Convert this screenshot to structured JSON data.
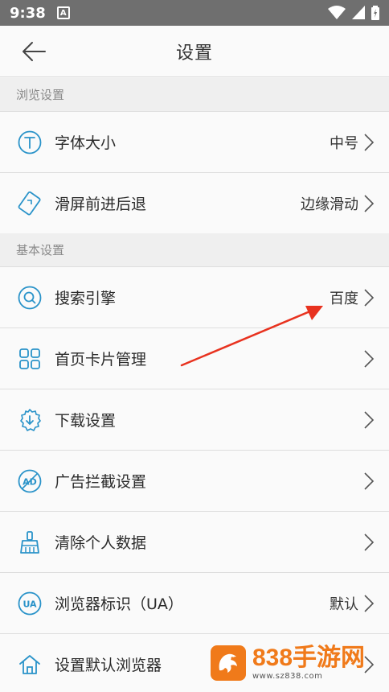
{
  "status_bar": {
    "time": "9:38",
    "notif_glyph": "A"
  },
  "toolbar": {
    "title": "设置"
  },
  "sections": {
    "browse": "浏览设置",
    "basic": "基本设置"
  },
  "rows": [
    {
      "label": "字体大小",
      "value": "中号",
      "icon": "font-size-icon"
    },
    {
      "label": "滑屏前进后退",
      "value": "边缘滑动",
      "icon": "swipe-gesture-icon"
    },
    {
      "label": "搜索引擎",
      "value": "百度",
      "icon": "search-icon"
    },
    {
      "label": "首页卡片管理",
      "value": "",
      "icon": "grid-icon"
    },
    {
      "label": "下载设置",
      "value": "",
      "icon": "download-icon"
    },
    {
      "label": "广告拦截设置",
      "value": "",
      "icon": "ad-block-icon"
    },
    {
      "label": "清除个人数据",
      "value": "",
      "icon": "broom-icon"
    },
    {
      "label": "浏览器标识（UA）",
      "value": "默认",
      "icon": "ua-icon"
    },
    {
      "label": "设置默认浏览器",
      "value": "",
      "icon": "home-icon"
    }
  ],
  "watermark": {
    "brand": "838手游网",
    "url": "www.sz838.com"
  },
  "colors": {
    "accent": "#2a93c9",
    "annotation_arrow": "#e8321f",
    "watermark": "#f07a1a"
  }
}
